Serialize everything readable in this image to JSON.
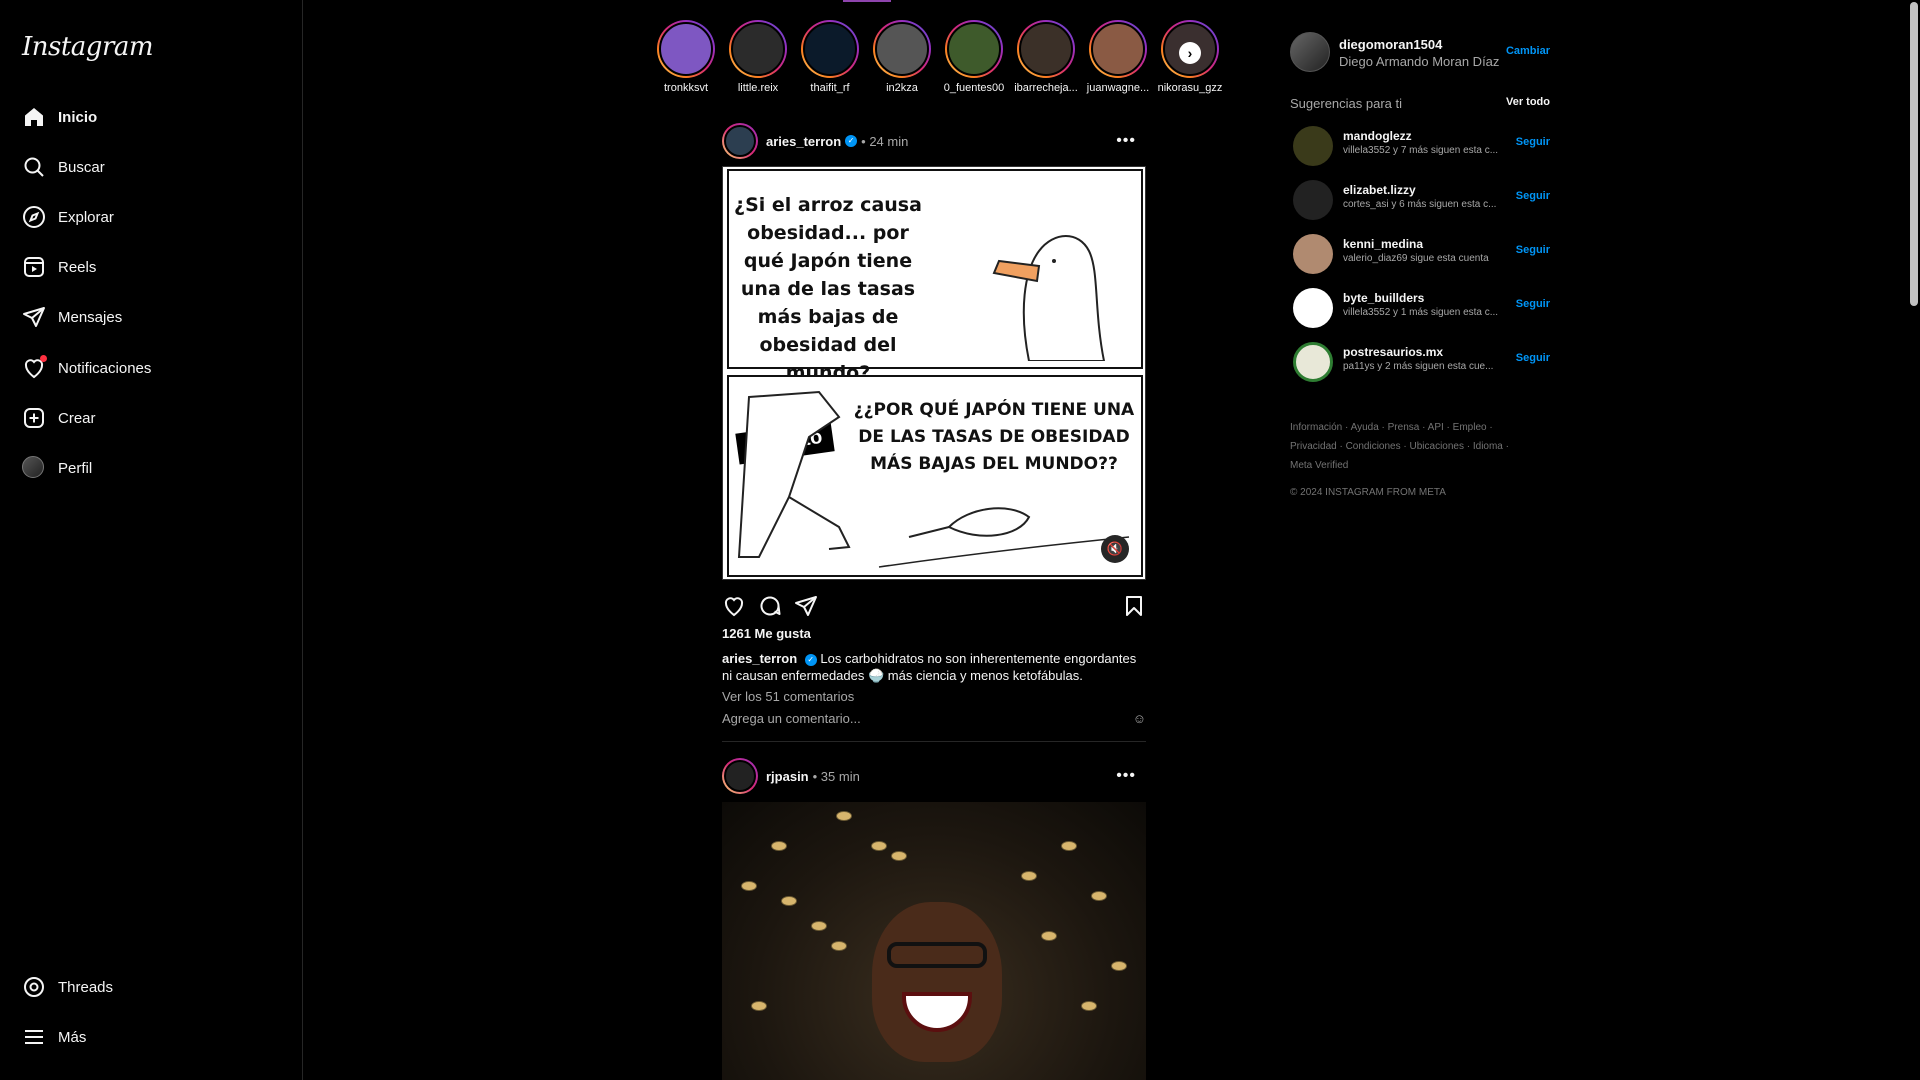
{
  "brand": {
    "logo": "Instagram"
  },
  "nav": {
    "items": [
      {
        "label": "Inicio",
        "icon": "home-icon"
      },
      {
        "label": "Buscar",
        "icon": "search-icon"
      },
      {
        "label": "Explorar",
        "icon": "compass-icon"
      },
      {
        "label": "Reels",
        "icon": "reels-icon"
      },
      {
        "label": "Mensajes",
        "icon": "send-icon"
      },
      {
        "label": "Notificaciones",
        "icon": "heart-icon"
      },
      {
        "label": "Crear",
        "icon": "plus-square-icon"
      },
      {
        "label": "Perfil",
        "icon": "avatar"
      }
    ],
    "bottom": [
      {
        "label": "Threads",
        "icon": "threads-icon"
      },
      {
        "label": "Más",
        "icon": "menu-icon"
      }
    ]
  },
  "stories": [
    {
      "name": "tronkksvt"
    },
    {
      "name": "little.reix"
    },
    {
      "name": "thaifit_rf"
    },
    {
      "name": "in2kza"
    },
    {
      "name": "0_fuentes00"
    },
    {
      "name": "ibarrecheja..."
    },
    {
      "name": "juanwagne..."
    },
    {
      "name": "nikorasu_gzz"
    }
  ],
  "posts": [
    {
      "user": "aries_terron",
      "time": "• 24 min",
      "meme_top": "¿Si el arroz causa obesidad... por qué Japón tiene una de las tasas más bajas de obesidad del mundo?",
      "meme_bottom": "¿¿POR QUÉ JAPÓN TIENE UNA DE LAS TASAS DE OBESIDAD MÁS BAJAS DEL MUNDO??",
      "meme_tag": "Ketonto",
      "likes": "1261 Me gusta",
      "caption_user": "aries_terron",
      "caption": "Los carbohidratos no son inherentemente engordantes ni causan enfermedades 🍚 más ciencia y menos ketofábulas.",
      "view_comments": "Ver los 51 comentarios",
      "add_comment": "Agrega un comentario..."
    },
    {
      "user": "rjpasin",
      "time": "• 35 min"
    }
  ],
  "right": {
    "me": {
      "user": "diegomoran1504",
      "name": "Diego Armando Moran Díaz",
      "switch": "Cambiar"
    },
    "suggestions_title": "Sugerencias para ti",
    "see_all": "Ver todo",
    "follow_label": "Seguir",
    "suggestions": [
      {
        "user": "mandoglezz",
        "desc": "villela3552 y 7 más siguen esta c..."
      },
      {
        "user": "elizabet.lizzy",
        "desc": "cortes_asi y 6 más siguen esta c..."
      },
      {
        "user": "kenni_medina",
        "desc": "valerio_diaz69 sigue esta cuenta"
      },
      {
        "user": "byte_buillders",
        "desc": "villela3552 y 1 más siguen esta c..."
      },
      {
        "user": "postresaurios.mx",
        "desc": "pa11ys y 2 más siguen esta cue..."
      }
    ],
    "footer_links": "Información · Ayuda · Prensa · API · Empleo · Privacidad · Condiciones · Ubicaciones · Idioma · Meta Verified",
    "copyright": "© 2024 INSTAGRAM FROM META"
  },
  "colors": {
    "accent": "#0095f6",
    "notification": "#ff3040",
    "background": "#000000"
  }
}
